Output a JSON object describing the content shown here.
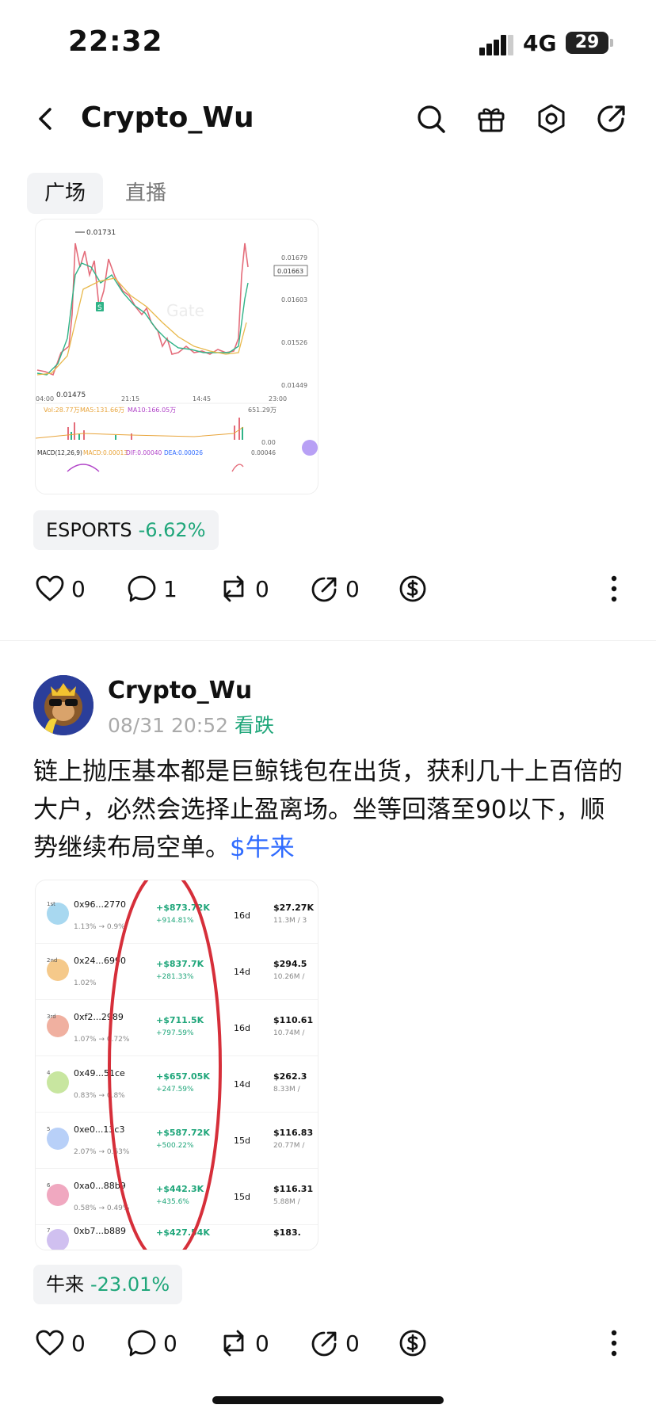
{
  "status": {
    "time": "22:32",
    "network": "4G",
    "battery": "29"
  },
  "nav": {
    "title": "Crypto_Wu",
    "icons": [
      "search-icon",
      "gift-icon",
      "settings-icon",
      "share-icon"
    ]
  },
  "tabs": [
    {
      "label": "广场"
    },
    {
      "label": "直播"
    }
  ],
  "post1": {
    "chart": {
      "watermark": "Gate",
      "high_label": "0.01731",
      "low_label": "0.01475",
      "price_ticks": [
        "0.01679",
        "0.01663",
        "0.01603",
        "0.01526",
        "0.01449"
      ],
      "time_ticks": [
        "04:00",
        "21:15",
        "14:45",
        "23:00"
      ],
      "vol_line": {
        "vol": "Vol:28.77万",
        "ma5": "MA5:131.66万",
        "ma10": "MA10:166.05万",
        "max": "651.29万",
        "zero": "0.00"
      },
      "macd_line": {
        "macd_label": "MACD(12,26,9)",
        "macd": "MACD:0.00013",
        "dif": "DIF:0.00040",
        "dea": "DEA:0.00026",
        "val": "0.00046"
      },
      "marker": "S"
    },
    "tag": {
      "name": "ESPORTS",
      "pct": "-6.62%"
    },
    "actions": {
      "likes": "0",
      "comments": "1",
      "reposts": "0",
      "shares": "0"
    }
  },
  "post2": {
    "author": "Crypto_Wu",
    "date": "08/31 20:52",
    "sentiment": "看跌",
    "text": "链上抛压基本都是巨鲸钱包在出货，获利几十上百倍的大户，必然会选择止盈离场。坐等回落至90以下，顺势继续布局空单。",
    "coin": "$牛来",
    "table": {
      "rows": [
        {
          "rank": "1st",
          "addr": "0x96...2770",
          "pct": "1.13% → 0.9%",
          "profit": "+$873.72K",
          "profit_pct": "+914.81%",
          "days": "16d",
          "val": "$27.27K",
          "sub": "11.3M / 3"
        },
        {
          "rank": "2nd",
          "addr": "0x24...6990",
          "pct": "1.02%",
          "profit": "+$837.7K",
          "profit_pct": "+281.33%",
          "days": "14d",
          "val": "$294.5",
          "sub": "10.26M /"
        },
        {
          "rank": "3rd",
          "addr": "0xf2...2989",
          "pct": "1.07% → 0.72%",
          "profit": "+$711.5K",
          "profit_pct": "+797.59%",
          "days": "16d",
          "val": "$110.61",
          "sub": "10.74M /"
        },
        {
          "rank": "4",
          "addr": "0x49...51ce",
          "pct": "0.83% → 0.8%",
          "profit": "+$657.05K",
          "profit_pct": "+247.59%",
          "days": "14d",
          "val": "$262.3",
          "sub": "8.33M /"
        },
        {
          "rank": "5",
          "addr": "0xe0...13c3",
          "pct": "2.07% → 0.63%",
          "profit": "+$587.72K",
          "profit_pct": "+500.22%",
          "days": "15d",
          "val": "$116.83",
          "sub": "20.77M /"
        },
        {
          "rank": "6",
          "addr": "0xa0...88b9",
          "pct": "0.58% → 0.49%",
          "profit": "+$442.3K",
          "profit_pct": "+435.6%",
          "days": "15d",
          "val": "$116.31",
          "sub": "5.88M /"
        },
        {
          "rank": "7",
          "addr": "0xb7...b889",
          "pct": "",
          "profit": "+$427.54K",
          "profit_pct": "",
          "days": "",
          "val": "$183.",
          "sub": ""
        }
      ]
    },
    "tag": {
      "name": "牛来",
      "pct": "-23.01%"
    },
    "actions": {
      "likes": "0",
      "comments": "0",
      "reposts": "0",
      "shares": "0"
    }
  },
  "colors": {
    "green": "#1fa67a",
    "blue": "#2f6bff",
    "red_circle": "#d62f3a"
  }
}
